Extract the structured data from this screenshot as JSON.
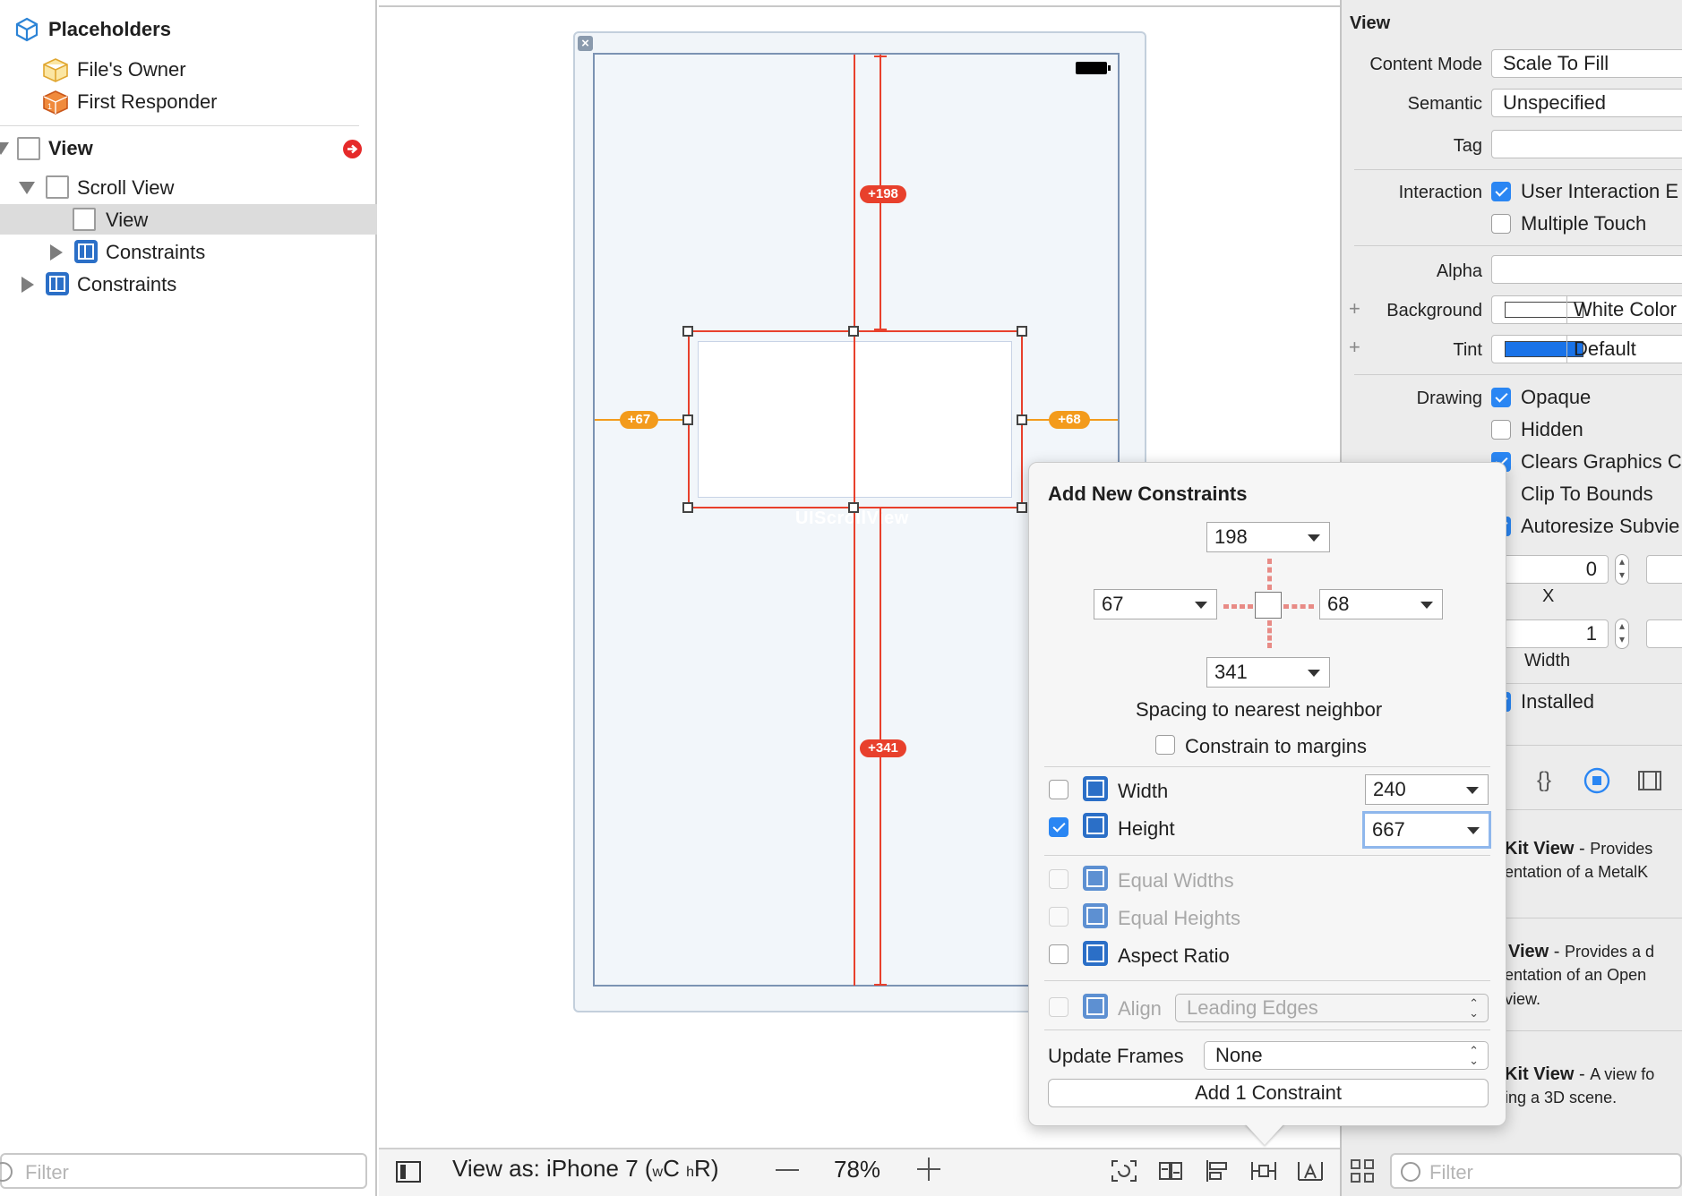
{
  "outline": {
    "placeholders": "Placeholders",
    "files_owner": "File's Owner",
    "first_responder": "First Responder",
    "view": "View",
    "scroll_view": "Scroll View",
    "inner_view": "View",
    "constraints_inner": "Constraints",
    "constraints_outer": "Constraints",
    "filter_placeholder": "Filter"
  },
  "canvas": {
    "scroll_view_caption": "UIScrollView",
    "badges": {
      "top": "+198",
      "bottom": "+341",
      "left": "+67",
      "right": "+68"
    }
  },
  "bottom_bar": {
    "view_as_prefix": "View as: iPhone 7 (",
    "size_w": "w",
    "size_c": "C",
    "size_h": "h",
    "size_r": "R",
    "view_as_suffix": ")",
    "zoom": "78%"
  },
  "inspector": {
    "section_title": "View",
    "content_mode_label": "Content Mode",
    "content_mode_value": "Scale To Fill",
    "semantic_label": "Semantic",
    "semantic_value": "Unspecified",
    "tag_label": "Tag",
    "tag_value": "",
    "interaction_label": "Interaction",
    "user_interaction": "User Interaction E",
    "multiple_touch": "Multiple Touch",
    "alpha_label": "Alpha",
    "alpha_value": "",
    "background_label": "Background",
    "background_value": "White Color",
    "tint_label": "Tint",
    "tint_value": "Default",
    "drawing_label": "Drawing",
    "opaque": "Opaque",
    "hidden": "Hidden",
    "clears_graphics": "Clears Graphics C",
    "clip_to_bounds": "Clip To Bounds",
    "autoresize": "Autoresize Subvie",
    "stretch_x_value": "0",
    "x_label": "X",
    "stretch_w_value": "1",
    "width_label": "Width",
    "installed": "Installed",
    "filter_placeholder": "Filter",
    "tint_color": "#1a73e8",
    "background_color": "#ffffff"
  },
  "library": [
    {
      "title": "Kit View",
      "sep": " - ",
      "desc1": "Provides",
      "desc2": "entation of a MetalK"
    },
    {
      "title": "View",
      "sep": " - ",
      "desc1": "Provides a d",
      "desc2": "entation of an Open",
      "desc3": "view."
    },
    {
      "title": "Kit View",
      "sep": " - ",
      "desc1": "A view fo",
      "desc2": "ing a 3D scene."
    }
  ],
  "popover": {
    "title": "Add New Constraints",
    "top": "198",
    "left": "67",
    "right": "68",
    "bottom": "341",
    "spacing_label": "Spacing to nearest neighbor",
    "constrain_margins": "Constrain to margins",
    "width_label": "Width",
    "width_value": "240",
    "height_label": "Height",
    "height_value": "667",
    "equal_widths": "Equal Widths",
    "equal_heights": "Equal Heights",
    "aspect_ratio": "Aspect Ratio",
    "align_label": "Align",
    "align_value": "Leading Edges",
    "update_frames_label": "Update Frames",
    "update_frames_value": "None",
    "add_button": "Add 1 Constraint"
  }
}
